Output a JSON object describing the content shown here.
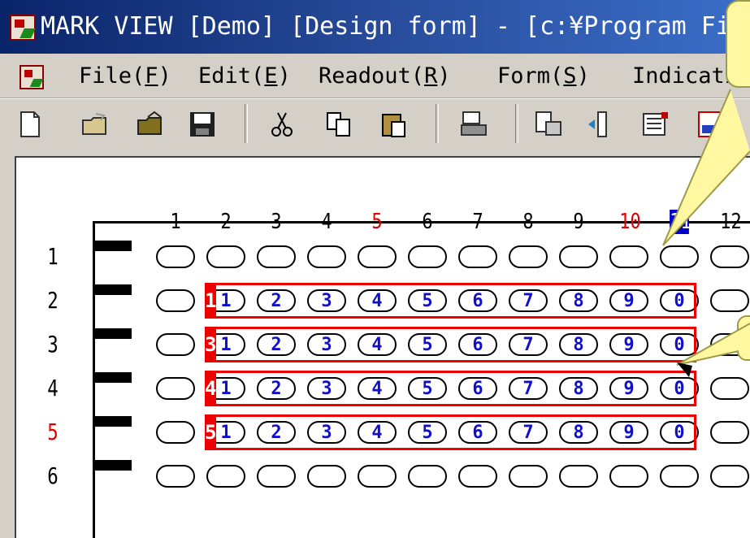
{
  "window": {
    "title": "MARK VIEW [Demo] [Design form] - [c:¥Program Fi"
  },
  "menu": [
    {
      "label": "File",
      "key": "F"
    },
    {
      "label": "Edit",
      "key": "E"
    },
    {
      "label": "Readout",
      "key": "R"
    },
    {
      "label": "Form",
      "key": "S"
    },
    {
      "label": "Indicatio",
      "key": ""
    }
  ],
  "toolbar": [
    {
      "icon": "new-file-icon"
    },
    {
      "icon": "open-folder-icon"
    },
    {
      "icon": "open-icon"
    },
    {
      "icon": "save-icon"
    },
    {
      "icon": "cut-icon"
    },
    {
      "icon": "copy-icon"
    },
    {
      "icon": "paste-icon"
    },
    {
      "icon": "scan-icon"
    },
    {
      "icon": "readout-icon"
    },
    {
      "icon": "flip-icon"
    },
    {
      "icon": "form-icon"
    },
    {
      "icon": "numbering-icon"
    }
  ],
  "grid": {
    "columns": [
      {
        "n": "1",
        "color": "#000000"
      },
      {
        "n": "2",
        "color": "#000000"
      },
      {
        "n": "3",
        "color": "#000000"
      },
      {
        "n": "4",
        "color": "#000000"
      },
      {
        "n": "5",
        "color": "#e00000"
      },
      {
        "n": "6",
        "color": "#000000"
      },
      {
        "n": "7",
        "color": "#000000"
      },
      {
        "n": "8",
        "color": "#000000"
      },
      {
        "n": "9",
        "color": "#000000"
      },
      {
        "n": "10",
        "color": "#e00000"
      },
      {
        "n": "11",
        "color": "#ffffff",
        "highlight": "#0000cc"
      },
      {
        "n": "12",
        "color": "#000000"
      }
    ],
    "rows": [
      {
        "n": "1",
        "color": "#000000"
      },
      {
        "n": "2",
        "color": "#000000"
      },
      {
        "n": "3",
        "color": "#000000"
      },
      {
        "n": "4",
        "color": "#000000"
      },
      {
        "n": "5",
        "color": "#e00000"
      },
      {
        "n": "6",
        "color": "#000000"
      }
    ],
    "bubble_digits": [
      "1",
      "2",
      "3",
      "4",
      "5",
      "6",
      "7",
      "8",
      "9",
      "0"
    ],
    "fields": [
      {
        "row": 2,
        "tag": "1"
      },
      {
        "row": 3,
        "tag": "3"
      },
      {
        "row": 4,
        "tag": "4"
      },
      {
        "row": 5,
        "tag": "5"
      }
    ]
  }
}
